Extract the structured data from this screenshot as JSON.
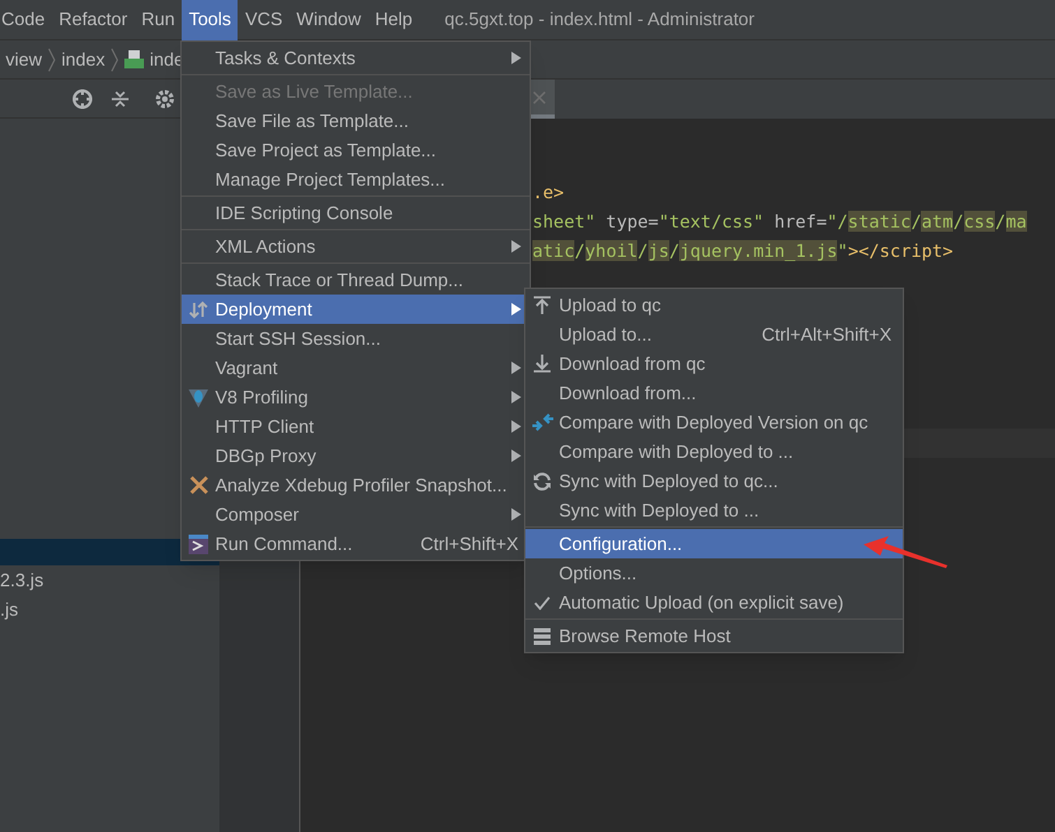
{
  "menu_bar": [
    {
      "label": "Code",
      "selected": false
    },
    {
      "label": "Refactor",
      "selected": false
    },
    {
      "label": "Run",
      "selected": false
    },
    {
      "label": "Tools",
      "selected": true
    },
    {
      "label": "VCS",
      "selected": false
    },
    {
      "label": "Window",
      "selected": false
    },
    {
      "label": "Help",
      "selected": false
    }
  ],
  "window": {
    "title": "qc.5gxt.top - index.html - Administrator"
  },
  "breadcrumbs": [
    "view",
    "index",
    "inde"
  ],
  "project_files": [
    {
      "name": "2.3.js",
      "selected": false
    },
    {
      "name": ".js",
      "selected": false
    }
  ],
  "code_lines": [
    [
      {
        "kind": "tag",
        "text": ".e>"
      }
    ],
    [
      {
        "kind": "string",
        "text": "sheet\""
      },
      {
        "kind": "attr",
        "text": " type="
      },
      {
        "kind": "string",
        "text": "\"text/css\""
      },
      {
        "kind": "attr",
        "text": " href="
      },
      {
        "kind": "string",
        "text": "\"/"
      },
      {
        "kind": "hl",
        "text": "static"
      },
      {
        "kind": "string",
        "text": "/"
      },
      {
        "kind": "hl",
        "text": "atm"
      },
      {
        "kind": "string",
        "text": "/"
      },
      {
        "kind": "hl",
        "text": "css"
      },
      {
        "kind": "string",
        "text": "/"
      },
      {
        "kind": "hl",
        "text": "ma"
      }
    ],
    [
      {
        "kind": "hl",
        "text": "atic"
      },
      {
        "kind": "string",
        "text": "/"
      },
      {
        "kind": "hl",
        "text": "yhoil"
      },
      {
        "kind": "string",
        "text": "/"
      },
      {
        "kind": "hl",
        "text": "js"
      },
      {
        "kind": "string",
        "text": "/"
      },
      {
        "kind": "hl",
        "text": "jquery.min_1.js"
      },
      {
        "kind": "string",
        "text": "\""
      },
      {
        "kind": "tag",
        "text": "></script>"
      }
    ]
  ],
  "tools_menu": [
    {
      "kind": "item",
      "label": "Tasks & Contexts",
      "submenu": true,
      "disabled": false,
      "selected": false
    },
    {
      "kind": "separator"
    },
    {
      "kind": "item",
      "label": "Save as Live Template...",
      "submenu": false,
      "disabled": true,
      "selected": false
    },
    {
      "kind": "item",
      "label": "Save File as Template...",
      "submenu": false,
      "disabled": false,
      "selected": false
    },
    {
      "kind": "item",
      "label": "Save Project as Template...",
      "submenu": false,
      "disabled": false,
      "selected": false
    },
    {
      "kind": "item",
      "label": "Manage Project Templates...",
      "submenu": false,
      "disabled": false,
      "selected": false
    },
    {
      "kind": "separator"
    },
    {
      "kind": "item",
      "label": "IDE Scripting Console",
      "submenu": false,
      "disabled": false,
      "selected": false
    },
    {
      "kind": "separator"
    },
    {
      "kind": "item",
      "label": "XML Actions",
      "submenu": true,
      "disabled": false,
      "selected": false
    },
    {
      "kind": "separator"
    },
    {
      "kind": "item",
      "label": "Stack Trace or Thread Dump...",
      "submenu": false,
      "disabled": false,
      "selected": false
    },
    {
      "kind": "item",
      "label": "Deployment",
      "submenu": true,
      "disabled": false,
      "selected": true
    },
    {
      "kind": "item",
      "label": "Start SSH Session...",
      "submenu": false,
      "disabled": false,
      "selected": false
    },
    {
      "kind": "item",
      "label": "Vagrant",
      "submenu": true,
      "disabled": false,
      "selected": false
    },
    {
      "kind": "item",
      "label": "V8 Profiling",
      "submenu": true,
      "disabled": false,
      "selected": false
    },
    {
      "kind": "item",
      "label": "HTTP Client",
      "submenu": true,
      "disabled": false,
      "selected": false
    },
    {
      "kind": "item",
      "label": "DBGp Proxy",
      "submenu": true,
      "disabled": false,
      "selected": false
    },
    {
      "kind": "item",
      "label": "Analyze Xdebug Profiler Snapshot...",
      "submenu": false,
      "disabled": false,
      "selected": false
    },
    {
      "kind": "item",
      "label": "Composer",
      "submenu": true,
      "disabled": false,
      "selected": false
    },
    {
      "kind": "item",
      "label": "Run Command...",
      "shortcut": "Ctrl+Shift+X",
      "submenu": false,
      "disabled": false,
      "selected": false
    }
  ],
  "deployment_menu": [
    {
      "kind": "item",
      "label": "Upload to qc",
      "selected": false,
      "checked": false
    },
    {
      "kind": "item",
      "label": "Upload to...",
      "shortcut": "Ctrl+Alt+Shift+X",
      "selected": false,
      "checked": false
    },
    {
      "kind": "item",
      "label": "Download from qc",
      "selected": false,
      "checked": false
    },
    {
      "kind": "item",
      "label": "Download from...",
      "selected": false,
      "checked": false
    },
    {
      "kind": "item",
      "label": "Compare with Deployed Version on qc",
      "selected": false,
      "checked": false
    },
    {
      "kind": "item",
      "label": "Compare with Deployed to ...",
      "selected": false,
      "checked": false
    },
    {
      "kind": "item",
      "label": "Sync with Deployed to qc...",
      "selected": false,
      "checked": false
    },
    {
      "kind": "item",
      "label": "Sync with Deployed to ...",
      "selected": false,
      "checked": false
    },
    {
      "kind": "separator"
    },
    {
      "kind": "item",
      "label": "Configuration...",
      "selected": true,
      "checked": false
    },
    {
      "kind": "item",
      "label": "Options...",
      "selected": false,
      "checked": false
    },
    {
      "kind": "item",
      "label": "Automatic Upload (on explicit save)",
      "selected": false,
      "checked": true
    },
    {
      "kind": "separator"
    },
    {
      "kind": "item",
      "label": "Browse Remote Host",
      "selected": false,
      "checked": false
    }
  ]
}
